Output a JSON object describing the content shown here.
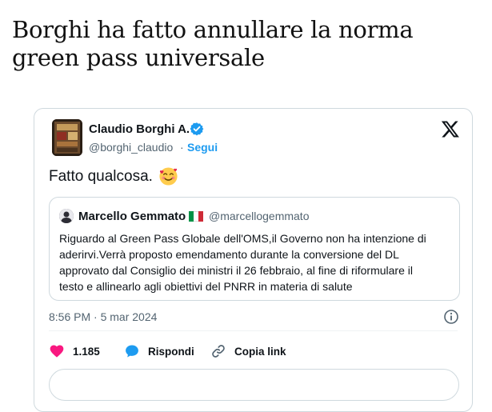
{
  "article": {
    "headline": "Borghi ha fatto annullare la norma green pass universale"
  },
  "tweet": {
    "author_name": "Claudio Borghi A.",
    "author_handle": "@borghi_claudio",
    "separator": "·",
    "follow_label": "Segui",
    "text": "Fatto qualcosa.",
    "emoji": "smiling-face-with-hearts",
    "timestamp": "8:56 PM · 5 mar 2024",
    "likes": "1.185",
    "reply_label": "Rispondi",
    "copy_link_label": "Copia link",
    "quoted": {
      "author_name": "Marcello Gemmato",
      "author_handle": "@marcellogemmato",
      "flag": "italy-flag",
      "lines": [
        "Riguardo al Green Pass Globale dell'OMS,il Governo non ha intenzione di",
        "aderirvi.Verrà proposto emendamento durante la conversione del DL",
        "approvato dal Consiglio dei ministri il 26 febbraio, al fine di riformulare il",
        "testo e allinearlo agli obiettivi del PNRR in materia di salute"
      ]
    }
  },
  "colors": {
    "accent": "#1d9bf0",
    "like": "#f91880",
    "muted": "#536471",
    "border": "#cfd9de"
  }
}
